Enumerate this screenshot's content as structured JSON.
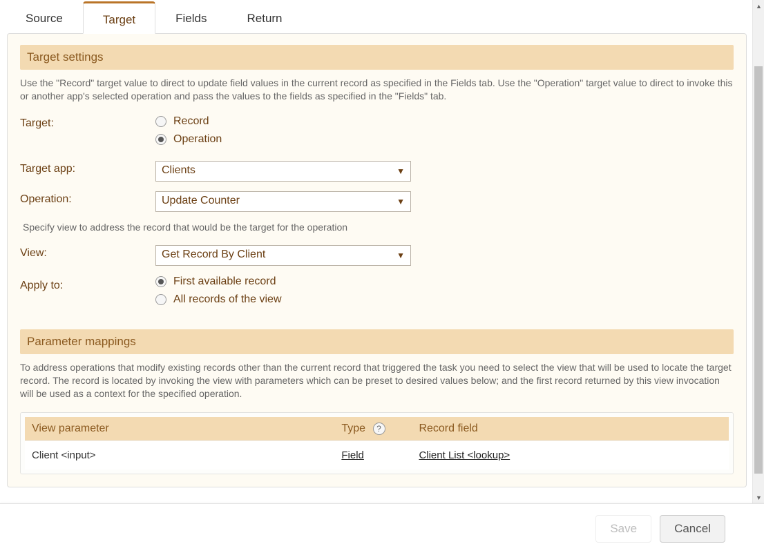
{
  "tabs": {
    "source": "Source",
    "target": "Target",
    "fields": "Fields",
    "return": "Return",
    "active": "target"
  },
  "target_settings": {
    "header": "Target settings",
    "description": "Use the \"Record\" target value to direct to update field values in the current record as specified in the Fields tab. Use the \"Operation\" target value to direct to invoke this or another app's selected operation and pass the values to the fields as specified in the \"Fields\" tab.",
    "target_label": "Target:",
    "target_options": {
      "record": "Record",
      "operation": "Operation",
      "selected": "operation"
    },
    "target_app_label": "Target app:",
    "target_app_value": "Clients",
    "operation_label": "Operation:",
    "operation_value": "Update Counter",
    "view_hint": "Specify view to address the record that would be the target for the operation",
    "view_label": "View:",
    "view_value": "Get Record By Client",
    "apply_to_label": "Apply to:",
    "apply_to_options": {
      "first": "First available record",
      "all": "All records of the view",
      "selected": "first"
    }
  },
  "param_mappings": {
    "header": "Parameter mappings",
    "description": "To address operations that modify existing records other than the current record that triggered the task you need to select the view that will be used to locate the target record. The record is located by invoking the view with parameters which can be preset to desired values below; and the first record returned by this view invocation will be used as a context for the specified operation.",
    "columns": {
      "view_parameter": "View parameter",
      "type": "Type",
      "record_field": "Record field"
    },
    "rows": [
      {
        "view_parameter": "Client <input>",
        "type": "Field",
        "record_field": "Client List <lookup>"
      }
    ]
  },
  "footer": {
    "save": "Save",
    "cancel": "Cancel"
  },
  "glyphs": {
    "caret": "▼",
    "help": "?",
    "arrow_up": "▲",
    "arrow_down": "▼"
  }
}
